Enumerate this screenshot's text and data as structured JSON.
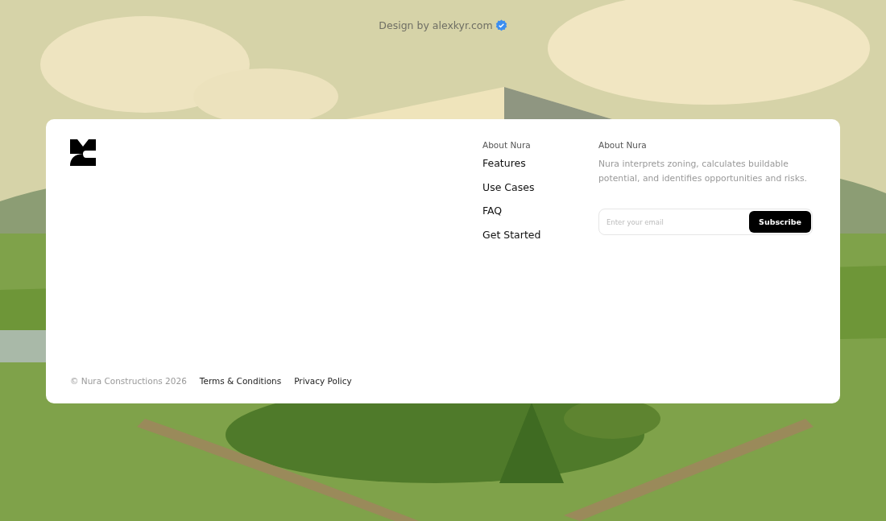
{
  "credit": {
    "text": "Design by alexkyr.com",
    "verified": true
  },
  "footer": {
    "nav_heading": "About Nura",
    "nav_links": [
      "Features",
      "Use Cases",
      "FAQ",
      "Get Started"
    ],
    "about_heading": "About Nura",
    "about_text": "Nura interprets zoning, calculates buildable potential, and identifies opportunities and risks.",
    "email_field": {
      "placeholder": "Enter your email"
    },
    "subscribe_button": "Subscribe",
    "copyright": "© Nura Constructions 2026",
    "legal_links": [
      "Terms & Conditions",
      "Privacy Policy"
    ]
  }
}
